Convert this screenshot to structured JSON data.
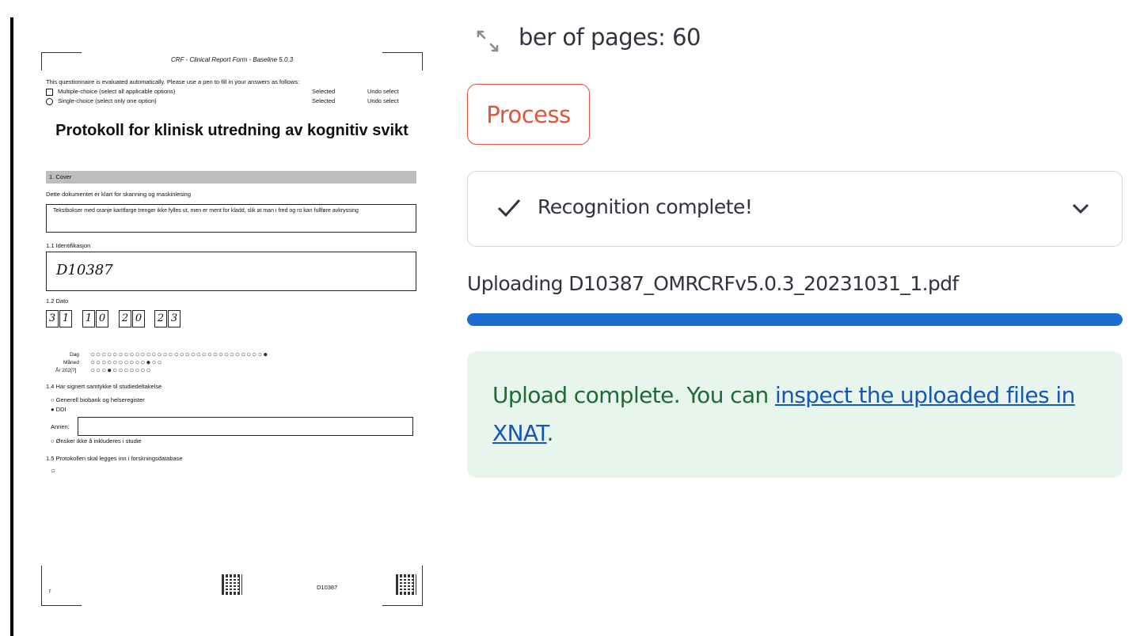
{
  "preview": {
    "header": "CRF - Clinical Report Form - Baseline 5.0.3",
    "instructions": "This questionnaire is evaluated automatically. Please use a pen to fill in your answers as follows:",
    "multi_label": "Multiple-choice (select all applicable options)",
    "single_label": "Single-choice (select only one option)",
    "selected": "Selected",
    "undo": "Undo select",
    "title": "Protokoll for klinisk utredning av kognitiv svikt",
    "section_cover": "1. Cover",
    "ready_label": "Dette dokumentet er klart for skanning og maskinlesing",
    "note": "Tekstbokser med oranje kantfarge trenger ikke fylles ut, men er ment for kladd, slik at man i fred og ro kan fullføre avkryssing",
    "ident_label": "1.1  Identifikasjon",
    "ident_value": "D10387",
    "date_label": "1.2  Dato",
    "date_digits": [
      "3",
      "1",
      "1",
      "0",
      "2",
      "0",
      "2",
      "3"
    ],
    "day_label": "Dag",
    "month_label": "Måned",
    "year_label": "År 202[?]",
    "consent_label": "1.4  Har signert samtykke til studiedeltakelse",
    "consent_opt1": "Generell biobank og helseregister",
    "consent_opt2": "DDI",
    "other_label": "Annen:",
    "consent_opt3": "Ønsker ikke å inkluderes i studie",
    "protocol_label": "1.5  Protokollen skal legges inn i forskningsdatabase",
    "footer_id": "D10387",
    "footer_page": "r"
  },
  "page_info": {
    "text": "ber of pages: 60"
  },
  "process_button": {
    "label": "Process"
  },
  "status": {
    "label": "Recognition complete!"
  },
  "upload": {
    "text": "Uploading D10387_OMRCRFv5.0.3_20231031_1.pdf",
    "progress": 1.0
  },
  "success": {
    "prefix": "Upload complete. You can ",
    "link": "inspect the uploaded files in XNAT",
    "suffix": "."
  },
  "colors": {
    "accent_red": "#e0543e",
    "progress_blue": "#1c6bd0",
    "success_bg": "#e8f5ec",
    "success_text": "#1d6a33",
    "link": "#1557b8"
  },
  "icons": {
    "expand": "expand-arrows-icon",
    "check": "checkmark-icon",
    "chevron": "chevron-down-icon"
  }
}
